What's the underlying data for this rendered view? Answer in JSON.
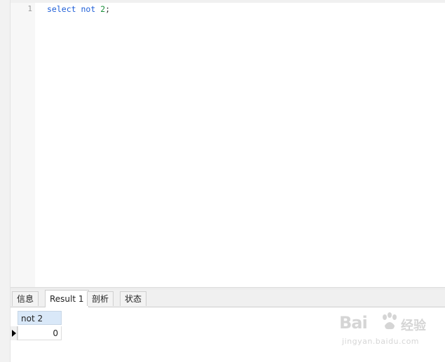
{
  "editor": {
    "line_number": "1",
    "tokens": {
      "kw_select": "select",
      "kw_not": "not",
      "number": "2",
      "semicolon": ";"
    }
  },
  "results": {
    "tabs": [
      {
        "label": "信息",
        "active": false
      },
      {
        "label": "Result 1",
        "active": true
      },
      {
        "label": "剖析",
        "active": false
      },
      {
        "label": "状态",
        "active": false
      }
    ],
    "grid": {
      "columns": [
        "not 2"
      ],
      "rows": [
        [
          "0"
        ]
      ]
    }
  },
  "watermark": {
    "logo_text": "Bai",
    "logo_text2": "经验",
    "url": "jingyan.baidu.com"
  },
  "colors": {
    "keyword": "#1f5fd8",
    "number": "#1a8f3a",
    "header_bg": "#d9e8f8"
  }
}
